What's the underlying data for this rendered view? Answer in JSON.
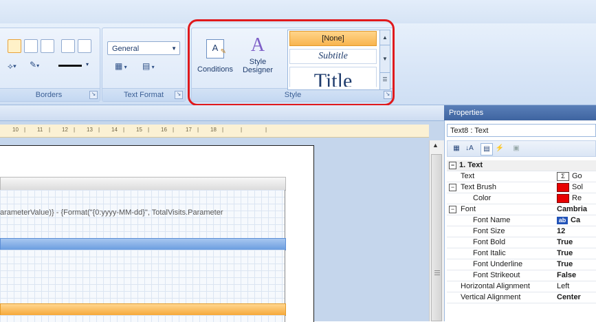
{
  "ribbon": {
    "borders_group": {
      "label": "Borders"
    },
    "text_format_group": {
      "label": "Text Format",
      "format_value": "General"
    },
    "style_group": {
      "label": "Style",
      "conditions_label": "Conditions",
      "style_designer_label_1": "Style",
      "style_designer_label_2": "Designer",
      "gallery_items": [
        "[None]",
        "Subtitle",
        "Title"
      ]
    },
    "highlight_color": "#e0191c"
  },
  "ruler": {
    "ticks": [
      "10",
      "11",
      "12",
      "13",
      "14",
      "15",
      "16",
      "17",
      "18"
    ]
  },
  "report": {
    "expression_text": "arameterValue)} - {Format(\"{0:yyyy-MM-dd}\", TotalVisits.Parameter"
  },
  "properties": {
    "title": "Properties",
    "object_selector": "Text8 : Text",
    "rows": [
      {
        "type": "category",
        "name": "1. Text",
        "value": ""
      },
      {
        "type": "prop",
        "name": "Text",
        "value": "Go",
        "icon": "sigma"
      },
      {
        "type": "parent",
        "name": "Text Brush",
        "value": "Sol",
        "icon": "swatch"
      },
      {
        "type": "child",
        "name": "Color",
        "value": "Re",
        "icon": "swatch"
      },
      {
        "type": "parent",
        "name": "Font",
        "value": "Cambria",
        "bold": true
      },
      {
        "type": "child",
        "name": "Font Name",
        "value": "Ca",
        "icon": "ab"
      },
      {
        "type": "child",
        "name": "Font Size",
        "value": "12",
        "bold": true
      },
      {
        "type": "child",
        "name": "Font Bold",
        "value": "True",
        "bold": true
      },
      {
        "type": "child",
        "name": "Font Italic",
        "value": "True",
        "bold": true
      },
      {
        "type": "child",
        "name": "Font Underline",
        "value": "True",
        "bold": true
      },
      {
        "type": "child",
        "name": "Font Strikeout",
        "value": "False",
        "bold": true
      },
      {
        "type": "prop",
        "name": "Horizontal Alignment",
        "value": "Left"
      },
      {
        "type": "prop",
        "name": "Vertical Alignment",
        "value": "Center",
        "bold": true
      }
    ]
  }
}
